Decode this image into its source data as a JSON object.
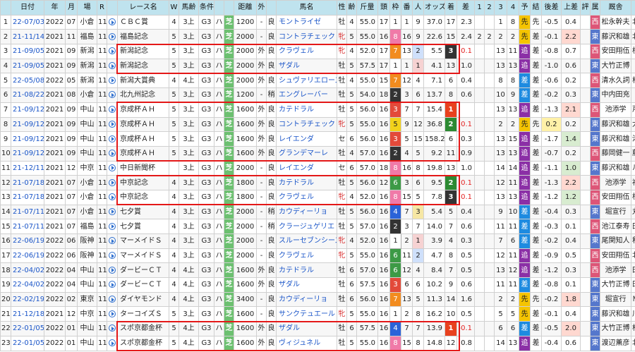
{
  "headers": [
    "",
    "日付",
    "年",
    "月",
    "場",
    "R",
    "",
    "レース名",
    "W",
    "馬齢",
    "条件",
    "",
    "",
    "距離",
    "外",
    "",
    "馬名",
    "性",
    "齢",
    "斤量",
    "頭",
    "枠",
    "番",
    "人",
    "オッズ",
    "着",
    "差",
    "1",
    "2",
    "3",
    "4",
    "予",
    "結",
    "後差",
    "上差",
    "評",
    "属",
    "厩舎",
    "騎手"
  ],
  "rows": [
    {
      "idx": "1",
      "date": "22-07/03",
      "year": "2022",
      "month": "07",
      "venue": "小倉",
      "r": "11",
      "race": "ＣＢＣ賞",
      "w": "4",
      "age": "3上",
      "grade": "G3",
      "hc": "ハ",
      "surf": "芝",
      "dist": "1200",
      "out": "-",
      "track": "良",
      "horse": "モントライゼ",
      "sex": "牡",
      "hage": "4",
      "kin": "55.0",
      "heads": "17",
      "waku": "1",
      "ban": "1",
      "pop": "9",
      "odds": "37.0",
      "fin": "17",
      "diff": "2.3",
      "c1": "",
      "c2": "",
      "c3": "1",
      "c4": "8",
      "yo": "先",
      "res": "先",
      "ato": "-0.5",
      "agari": "0.4",
      "hyo": "",
      "zoku": "西",
      "stable": "松永幹夫",
      "jockey": "北村友一"
    },
    {
      "idx": "2",
      "date": "21-11/14",
      "year": "2021",
      "month": "11",
      "venue": "福島",
      "r": "11",
      "race": "福島記念",
      "w": "5",
      "age": "3上",
      "grade": "G3",
      "hc": "ハ",
      "surf": "芝",
      "dist": "2000",
      "out": "-",
      "track": "良",
      "horse": "コントラチェック",
      "sex": "牝",
      "hage": "5",
      "kin": "55.0",
      "heads": "16",
      "waku": "8",
      "ban": "16",
      "pop": "9",
      "odds": "22.6",
      "fin": "15",
      "diff": "2.4",
      "c1": "2",
      "c2": "2",
      "c3": "2",
      "c4": "2",
      "yo": "先",
      "res": "差",
      "ato": "-0.1",
      "agari": "2.2",
      "hyo": "",
      "zoku": "東",
      "stable": "藤沢和雄",
      "jockey": "北村宏司"
    },
    {
      "idx": "3",
      "date": "21-09/05",
      "year": "2021",
      "month": "09",
      "venue": "新潟",
      "r": "11",
      "race": "新潟記念",
      "w": "5",
      "age": "3上",
      "grade": "G3",
      "hc": "ハ",
      "surf": "芝",
      "dist": "2000",
      "out": "外",
      "track": "良",
      "horse": "クラヴェル",
      "sex": "牝",
      "hage": "4",
      "kin": "52.0",
      "heads": "17",
      "waku": "7",
      "ban": "13",
      "pop": "2",
      "odds": "5.5",
      "fin": "3",
      "diff": "0.1",
      "c1": "",
      "c2": "",
      "c3": "13",
      "c4": "11",
      "yo": "追",
      "res": "差",
      "ato": "-0.8",
      "agari": "0.7",
      "hyo": "",
      "zoku": "西",
      "stable": "安田翔伍",
      "jockey": "横山典弘"
    },
    {
      "idx": "4",
      "date": "21-09/05",
      "year": "2021",
      "month": "09",
      "venue": "新潟",
      "r": "11",
      "race": "新潟記念",
      "w": "5",
      "age": "3上",
      "grade": "G3",
      "hc": "ハ",
      "surf": "芝",
      "dist": "2000",
      "out": "外",
      "track": "良",
      "horse": "ザダル",
      "sex": "牡",
      "hage": "5",
      "kin": "57.5",
      "heads": "17",
      "waku": "1",
      "ban": "1",
      "pop": "1",
      "odds": "4.1",
      "fin": "13",
      "diff": "1.0",
      "c1": "",
      "c2": "",
      "c3": "13",
      "c4": "13",
      "yo": "追",
      "res": "差",
      "ato": "-1.0",
      "agari": "0.6",
      "hyo": "",
      "zoku": "東",
      "stable": "大竹正博",
      "jockey": "石橋脩"
    },
    {
      "idx": "5",
      "date": "22-05/08",
      "year": "2022",
      "month": "05",
      "venue": "新潟",
      "r": "11",
      "race": "新潟大賞典",
      "w": "4",
      "age": "4上",
      "grade": "G3",
      "hc": "ハ",
      "surf": "芝",
      "dist": "2000",
      "out": "外",
      "track": "良",
      "horse": "シュヴァリエローズ",
      "sex": "牡",
      "hage": "4",
      "kin": "55.0",
      "heads": "15",
      "waku": "7",
      "ban": "12",
      "pop": "4",
      "odds": "7.1",
      "fin": "6",
      "diff": "0.4",
      "c1": "",
      "c2": "",
      "c3": "8",
      "c4": "8",
      "yo": "差",
      "res": "差",
      "ato": "-0.6",
      "agari": "0.2",
      "hyo": "",
      "zoku": "西",
      "stable": "清水久詞",
      "jockey": "松山弘平"
    },
    {
      "idx": "6",
      "date": "21-08/22",
      "year": "2021",
      "month": "08",
      "venue": "小倉",
      "r": "11",
      "race": "北九州記念",
      "w": "5",
      "age": "3上",
      "grade": "G3",
      "hc": "ハ",
      "surf": "芝",
      "dist": "1200",
      "out": "-",
      "track": "稍",
      "horse": "エングレーバー",
      "sex": "牡",
      "hage": "5",
      "kin": "54.0",
      "heads": "18",
      "waku": "2",
      "ban": "3",
      "pop": "6",
      "odds": "13.7",
      "fin": "8",
      "diff": "0.6",
      "c1": "",
      "c2": "",
      "c3": "10",
      "c4": "9",
      "yo": "差",
      "res": "差",
      "ato": "-0.2",
      "agari": "0.3",
      "hyo": "",
      "zoku": "東",
      "stable": "中内田充",
      "jockey": "浜中俊"
    },
    {
      "idx": "7",
      "date": "21-09/12",
      "year": "2021",
      "month": "09",
      "venue": "中山",
      "r": "11",
      "race": "京成杯ＡＨ",
      "w": "5",
      "age": "3上",
      "grade": "G3",
      "hc": "ハ",
      "surf": "芝",
      "dist": "1600",
      "out": "外",
      "track": "良",
      "horse": "カテドラル",
      "sex": "牡",
      "hage": "5",
      "kin": "56.0",
      "heads": "16",
      "waku": "3",
      "ban": "7",
      "pop": "7",
      "odds": "15.4",
      "fin": "1",
      "diff": "",
      "c1": "",
      "c2": "",
      "c3": "13",
      "c4": "13",
      "yo": "追",
      "res": "差",
      "ato": "-1.3",
      "agari": "2.1",
      "hyo": "",
      "zoku": "西",
      "stable": "池添学",
      "jockey": "戸崎圭太"
    },
    {
      "idx": "8",
      "date": "21-09/12",
      "year": "2021",
      "month": "09",
      "venue": "中山",
      "r": "11",
      "race": "京成杯ＡＨ",
      "w": "5",
      "age": "3上",
      "grade": "G3",
      "hc": "ハ",
      "surf": "芝",
      "dist": "1600",
      "out": "外",
      "track": "良",
      "horse": "コントラチェック",
      "sex": "牝",
      "hage": "5",
      "kin": "55.0",
      "heads": "16",
      "waku": "5",
      "ban": "9",
      "pop": "12",
      "odds": "36.8",
      "fin": "2",
      "diff": "0.1",
      "c1": "",
      "c2": "",
      "c3": "2",
      "c4": "2",
      "yo": "先",
      "res": "先",
      "ato": "0.2",
      "agari": "0.2",
      "hyo": "",
      "zoku": "東",
      "stable": "藤沢和雄",
      "jockey": "大野拓弥"
    },
    {
      "idx": "9",
      "date": "21-09/12",
      "year": "2021",
      "month": "09",
      "venue": "中山",
      "r": "11",
      "race": "京成杯ＡＨ",
      "w": "5",
      "age": "3上",
      "grade": "G3",
      "hc": "ハ",
      "surf": "芝",
      "dist": "1600",
      "out": "外",
      "track": "良",
      "horse": "レイエンダ",
      "sex": "セ",
      "hage": "6",
      "kin": "56.0",
      "heads": "16",
      "waku": "3",
      "ban": "5",
      "pop": "15",
      "odds": "158.2",
      "fin": "6",
      "diff": "0.3",
      "c1": "",
      "c2": "",
      "c3": "13",
      "c4": "15",
      "yo": "追",
      "res": "差",
      "ato": "-1.7",
      "agari": "1.4",
      "hyo": "",
      "zoku": "東",
      "stable": "藤沢和雄",
      "jockey": "津村明秀"
    },
    {
      "idx": "10",
      "date": "21-09/12",
      "year": "2021",
      "month": "09",
      "venue": "中山",
      "r": "11",
      "race": "京成杯ＡＨ",
      "w": "5",
      "age": "3上",
      "grade": "G3",
      "hc": "ハ",
      "surf": "芝",
      "dist": "1600",
      "out": "外",
      "track": "良",
      "horse": "グランデマーレ",
      "sex": "牡",
      "hage": "4",
      "kin": "57.0",
      "heads": "16",
      "waku": "2",
      "ban": "4",
      "pop": "5",
      "odds": "9.2",
      "fin": "11",
      "diff": "0.9",
      "c1": "",
      "c2": "",
      "c3": "13",
      "c4": "13",
      "yo": "追",
      "res": "差",
      "ato": "-0.7",
      "agari": "0.2",
      "hyo": "",
      "zoku": "西",
      "stable": "藤岡健一",
      "jockey": "藤岡康太"
    },
    {
      "idx": "11",
      "date": "21-12/11",
      "year": "2021",
      "month": "12",
      "venue": "中京",
      "r": "11",
      "race": "中日新聞杯",
      "w": "",
      "age": "3上",
      "grade": "G3",
      "hc": "ハ",
      "surf": "芝",
      "dist": "2000",
      "out": "-",
      "track": "良",
      "horse": "レイエンダ",
      "sex": "セ",
      "hage": "6",
      "kin": "57.0",
      "heads": "18",
      "waku": "8",
      "ban": "16",
      "pop": "8",
      "odds": "19.8",
      "fin": "13",
      "diff": "1.0",
      "c1": "",
      "c2": "",
      "c3": "14",
      "c4": "14",
      "yo": "追",
      "res": "差",
      "ato": "-1.1",
      "agari": "1.0",
      "hyo": "",
      "zoku": "東",
      "stable": "藤沢和雄",
      "jockey": "ルメール"
    },
    {
      "idx": "12",
      "date": "21-07/18",
      "year": "2021",
      "month": "07",
      "venue": "小倉",
      "r": "11",
      "race": "中京記念",
      "w": "4",
      "age": "3上",
      "grade": "G3",
      "hc": "ハ",
      "surf": "芝",
      "dist": "1800",
      "out": "-",
      "track": "良",
      "horse": "カテドラル",
      "sex": "牡",
      "hage": "5",
      "kin": "56.0",
      "heads": "12",
      "waku": "6",
      "ban": "3",
      "pop": "6",
      "odds": "9.5",
      "fin": "2",
      "diff": "0.1",
      "c1": "",
      "c2": "",
      "c3": "12",
      "c4": "11",
      "yo": "追",
      "res": "差",
      "ato": "-1.3",
      "agari": "2.2",
      "hyo": "",
      "zoku": "西",
      "stable": "池添学",
      "jockey": "福永祐一"
    },
    {
      "idx": "13",
      "date": "21-07/18",
      "year": "2021",
      "month": "07",
      "venue": "小倉",
      "r": "11",
      "race": "中京記念",
      "w": "4",
      "age": "3上",
      "grade": "G3",
      "hc": "ハ",
      "surf": "芝",
      "dist": "1800",
      "out": "-",
      "track": "良",
      "horse": "クラヴェル",
      "sex": "牝",
      "hage": "4",
      "kin": "52.0",
      "heads": "16",
      "waku": "8",
      "ban": "15",
      "pop": "5",
      "odds": "7.8",
      "fin": "3",
      "diff": "0.1",
      "c1": "",
      "c2": "",
      "c3": "13",
      "c4": "13",
      "yo": "追",
      "res": "差",
      "ato": "-1.2",
      "agari": "1.2",
      "hyo": "",
      "zoku": "西",
      "stable": "安田翔伍",
      "jockey": "横山典弘"
    },
    {
      "idx": "14",
      "date": "21-07/11",
      "year": "2021",
      "month": "07",
      "venue": "小倉",
      "r": "11",
      "race": "七夕賞",
      "w": "4",
      "age": "3上",
      "grade": "G3",
      "hc": "ハ",
      "surf": "芝",
      "dist": "2000",
      "out": "-",
      "track": "稍",
      "horse": "カウディーリョ",
      "sex": "牡",
      "hage": "5",
      "kin": "56.0",
      "heads": "16",
      "waku": "4",
      "ban": "7",
      "pop": "3",
      "odds": "5.4",
      "fin": "5",
      "diff": "0.4",
      "c1": "",
      "c2": "",
      "c3": "9",
      "c4": "10",
      "yo": "差",
      "res": "差",
      "ato": "-0.4",
      "agari": "0.3",
      "hyo": "",
      "zoku": "東",
      "stable": "堀宣行",
      "jockey": "丸山元気"
    },
    {
      "idx": "15",
      "date": "21-07/11",
      "year": "2021",
      "month": "07",
      "venue": "福島",
      "r": "11",
      "race": "七夕賞",
      "w": "4",
      "age": "3上",
      "grade": "G3",
      "hc": "ハ",
      "surf": "芝",
      "dist": "2000",
      "out": "-",
      "track": "稍",
      "horse": "クラージュゲリエ",
      "sex": "牡",
      "hage": "5",
      "kin": "57.0",
      "heads": "16",
      "waku": "2",
      "ban": "3",
      "pop": "7",
      "odds": "14.0",
      "fin": "7",
      "diff": "0.6",
      "c1": "",
      "c2": "",
      "c3": "11",
      "c4": "11",
      "yo": "差",
      "res": "差",
      "ato": "-0.3",
      "agari": "0.1",
      "hyo": "",
      "zoku": "西",
      "stable": "池江泰寿",
      "jockey": "田辺裕信"
    },
    {
      "idx": "16",
      "date": "22-06/19",
      "year": "2022",
      "month": "06",
      "venue": "阪神",
      "r": "11",
      "race": "マーメイドＳ",
      "w": "4",
      "age": "3上",
      "grade": "G3",
      "hc": "ハ",
      "surf": "芝",
      "dist": "2000",
      "out": "-",
      "track": "良",
      "horse": "スルーセブンシーズ",
      "sex": "牝",
      "hage": "4",
      "kin": "52.0",
      "heads": "16",
      "waku": "1",
      "ban": "2",
      "pop": "1",
      "odds": "3.9",
      "fin": "4",
      "diff": "0.3",
      "c1": "",
      "c2": "",
      "c3": "7",
      "c4": "6",
      "yo": "差",
      "res": "差",
      "ato": "-0.2",
      "agari": "0.4",
      "hyo": "",
      "zoku": "東",
      "stable": "尾関知人",
      "jockey": "秋山真一"
    },
    {
      "idx": "17",
      "date": "22-06/19",
      "year": "2022",
      "month": "06",
      "venue": "阪神",
      "r": "11",
      "race": "マーメイドＳ",
      "w": "4",
      "age": "3上",
      "grade": "G3",
      "hc": "ハ",
      "surf": "芝",
      "dist": "2000",
      "out": "-",
      "track": "良",
      "horse": "クラヴェル",
      "sex": "牝",
      "hage": "5",
      "kin": "55.0",
      "heads": "16",
      "waku": "6",
      "ban": "11",
      "pop": "2",
      "odds": "4.7",
      "fin": "8",
      "diff": "0.5",
      "c1": "",
      "c2": "",
      "c3": "12",
      "c4": "11",
      "yo": "追",
      "res": "差",
      "ato": "-0.9",
      "agari": "0.5",
      "hyo": "",
      "zoku": "西",
      "stable": "安田翔伍",
      "jockey": "北村友一"
    },
    {
      "idx": "18",
      "date": "22-04/02",
      "year": "2022",
      "month": "04",
      "venue": "中山",
      "r": "11",
      "race": "ダービーＣＴ",
      "w": "4",
      "age": "4上",
      "grade": "G3",
      "hc": "ハ",
      "surf": "芝",
      "dist": "1600",
      "out": "外",
      "track": "良",
      "horse": "カテドラル",
      "sex": "牡",
      "hage": "6",
      "kin": "57.0",
      "heads": "16",
      "waku": "6",
      "ban": "12",
      "pop": "4",
      "odds": "8.4",
      "fin": "7",
      "diff": "0.5",
      "c1": "",
      "c2": "",
      "c3": "13",
      "c4": "12",
      "yo": "追",
      "res": "差",
      "ato": "-1.2",
      "agari": "0.3",
      "hyo": "",
      "zoku": "西",
      "stable": "池添学",
      "jockey": "田辺裕信"
    },
    {
      "idx": "19",
      "date": "22-04/02",
      "year": "2022",
      "month": "04",
      "venue": "中山",
      "r": "11",
      "race": "ダービーＣＴ",
      "w": "4",
      "age": "4上",
      "grade": "G3",
      "hc": "ハ",
      "surf": "芝",
      "dist": "1600",
      "out": "外",
      "track": "良",
      "horse": "ザダル",
      "sex": "牡",
      "hage": "6",
      "kin": "57.5",
      "heads": "16",
      "waku": "3",
      "ban": "6",
      "pop": "6",
      "odds": "10.2",
      "fin": "9",
      "diff": "0.6",
      "c1": "",
      "c2": "",
      "c3": "11",
      "c4": "11",
      "yo": "差",
      "res": "差",
      "ato": "-0.8",
      "agari": "0.1",
      "hyo": "",
      "zoku": "東",
      "stable": "大竹正博",
      "jockey": "田辺裕信"
    },
    {
      "idx": "20",
      "date": "22-02/19",
      "year": "2022",
      "month": "02",
      "venue": "東京",
      "r": "11",
      "race": "ダイヤモンド",
      "w": "4",
      "age": "4上",
      "grade": "G3",
      "hc": "ハ",
      "surf": "芝",
      "dist": "3400",
      "out": "-",
      "track": "良",
      "horse": "カウディーリョ",
      "sex": "牡",
      "hage": "6",
      "kin": "56.0",
      "heads": "16",
      "waku": "7",
      "ban": "13",
      "pop": "5",
      "odds": "11.3",
      "fin": "14",
      "diff": "1.6",
      "c1": "",
      "c2": "",
      "c3": "2",
      "c4": "2",
      "yo": "先",
      "res": "先",
      "ato": "-0.2",
      "agari": "1.8",
      "hyo": "",
      "zoku": "東",
      "stable": "堀宣行",
      "jockey": "Ｍ．デム"
    },
    {
      "idx": "21",
      "date": "21-12/18",
      "year": "2021",
      "month": "12",
      "venue": "中京",
      "r": "11",
      "race": "ターコイズＳ",
      "w": "5",
      "age": "3上",
      "grade": "G3",
      "hc": "ハ",
      "surf": "芝",
      "dist": "1600",
      "out": "-",
      "track": "良",
      "horse": "サンクテュエール",
      "sex": "牝",
      "hage": "5",
      "kin": "55.0",
      "heads": "16",
      "waku": "1",
      "ban": "2",
      "pop": "8",
      "odds": "16.2",
      "fin": "10",
      "diff": "0.5",
      "c1": "",
      "c2": "",
      "c3": "5",
      "c4": "5",
      "yo": "先",
      "res": "差",
      "ato": "-0.1",
      "agari": "0.4",
      "hyo": "",
      "zoku": "東",
      "stable": "藤沢和雄",
      "jockey": "川田将雅"
    },
    {
      "idx": "22",
      "date": "22-01/05",
      "year": "2022",
      "month": "01",
      "venue": "中山",
      "r": "11",
      "race": "スポ京都金杯",
      "w": "5",
      "age": "4上",
      "grade": "G3",
      "hc": "ハ",
      "surf": "芝",
      "dist": "1600",
      "out": "外",
      "track": "良",
      "horse": "ザダル",
      "sex": "牡",
      "hage": "6",
      "kin": "57.5",
      "heads": "16",
      "waku": "4",
      "ban": "7",
      "pop": "7",
      "odds": "13.9",
      "fin": "1",
      "diff": "-0.1",
      "c1": "",
      "c2": "",
      "c3": "6",
      "c4": "6",
      "yo": "差",
      "res": "差",
      "ato": "-0.5",
      "agari": "2.0",
      "hyo": "",
      "zoku": "東",
      "stable": "大竹正博",
      "jockey": "松山弘平"
    },
    {
      "idx": "23",
      "date": "22-01/05",
      "year": "2022",
      "month": "01",
      "venue": "中山",
      "r": "11",
      "race": "スポ京都金杯",
      "w": "5",
      "age": "4上",
      "grade": "G3",
      "hc": "ハ",
      "surf": "芝",
      "dist": "1600",
      "out": "外",
      "track": "良",
      "horse": "ヴィジュネル",
      "sex": "牡",
      "hage": "5",
      "kin": "55.0",
      "heads": "16",
      "waku": "8",
      "ban": "15",
      "pop": "8",
      "odds": "14.8",
      "fin": "12",
      "diff": "0.8",
      "c1": "",
      "c2": "",
      "c3": "14",
      "c4": "13",
      "yo": "追",
      "res": "差",
      "ato": "-0.4",
      "agari": "0.6",
      "hyo": "",
      "zoku": "東",
      "stable": "渡辺薫彦",
      "jockey": "北村宏司"
    }
  ],
  "colors": {
    "header": "#bfe3ee",
    "highlight_box": "#e41818",
    "turf": "#6cc070",
    "link": "#1a55c8"
  }
}
